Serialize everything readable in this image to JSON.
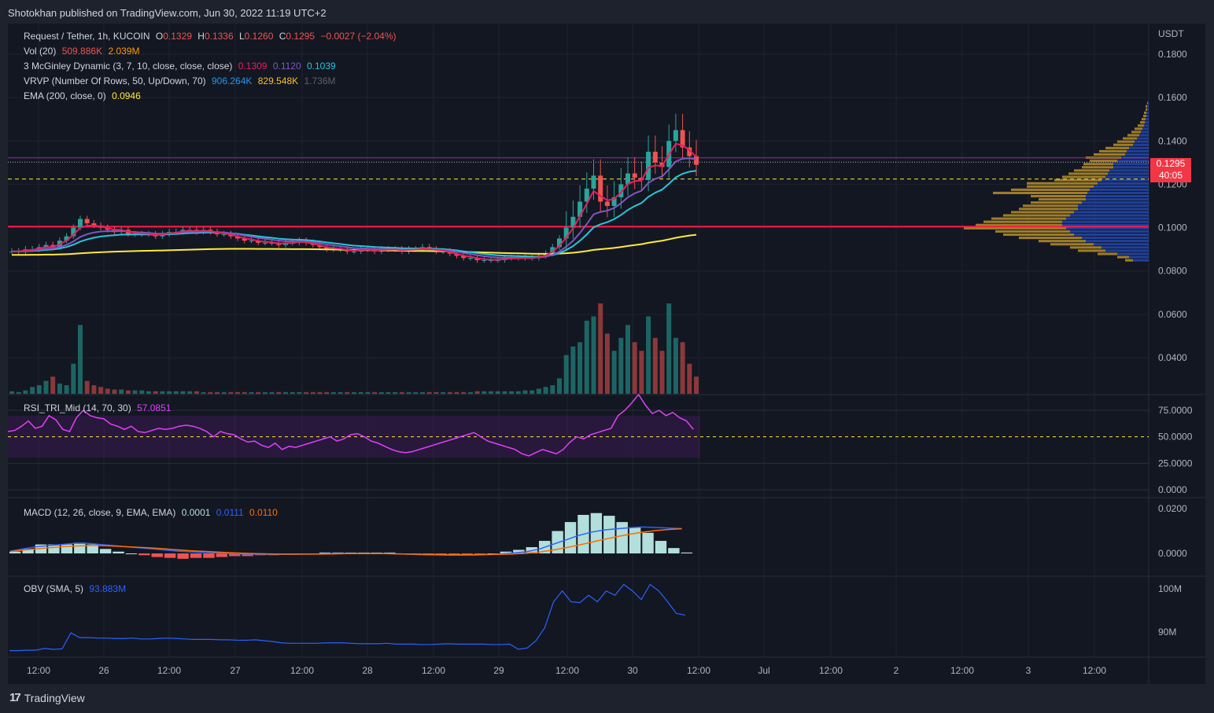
{
  "header": {
    "published": "Shotokhan published on TradingView.com, Jun 30, 2022 11:19 UTC+2"
  },
  "brand": {
    "name": "TradingView"
  },
  "colors": {
    "bg": "#131722",
    "up": "#26a69a",
    "down": "#ef5350",
    "red_line": "#ff1744",
    "yellow": "#ffeb3b",
    "mcg1": "#e91e63",
    "mcg2": "#7e57c2",
    "mcg3": "#26c6da",
    "rsi": "#e040fb",
    "obv": "#2962ff"
  },
  "legend": {
    "main": {
      "symbol": "Request / Tether, 1h, KUCOIN",
      "o_label": "O",
      "o": "0.1329",
      "h_label": "H",
      "h": "0.1336",
      "l_label": "L",
      "l": "0.1260",
      "c_label": "C",
      "c": "0.1295",
      "change": "−0.0027 (−2.04%)"
    },
    "vol": {
      "label": "Vol (20)",
      "v1": "509.886K",
      "v2": "2.039M"
    },
    "mcginley": {
      "label": "3 McGinley Dynamic (3, 7, 10, close, close, close)",
      "v1": "0.1309",
      "v2": "0.1120",
      "v3": "0.1039"
    },
    "vrvp": {
      "label": "VRVP (Number Of Rows, 50, Up/Down, 70)",
      "v1": "906.264K",
      "v2": "829.548K",
      "v3": "1.736M"
    },
    "ema": {
      "label": "EMA (200, close, 0)",
      "v1": "0.0946"
    },
    "rsi": {
      "label": "RSI_TRI_Mid (14, 70, 30)",
      "v1": "57.0851"
    },
    "macd": {
      "label": "MACD (12, 26, close, 9, EMA, EMA)",
      "v1": "0.0001",
      "v2": "0.0111",
      "v3": "0.0110"
    },
    "obv": {
      "label": "OBV (SMA, 5)",
      "v1": "93.883M"
    }
  },
  "price_tag": {
    "price": "0.1295",
    "countdown": "40:05"
  },
  "chart_data": [
    {
      "type": "candlestick",
      "title": "Request / Tether, 1h, KUCOIN",
      "ylabel": "USDT",
      "ylim": [
        0.02,
        0.19
      ],
      "y_ticks": [
        "0.1800",
        "0.1600",
        "0.1400",
        "0.1200",
        "0.1000",
        "0.0800",
        "0.0600",
        "0.0400"
      ],
      "x_ticks": [
        "12:00",
        "26",
        "12:00",
        "27",
        "12:00",
        "28",
        "12:00",
        "29",
        "12:00",
        "30",
        "12:00",
        "Jul",
        "12:00",
        "2",
        "12:00",
        "3",
        "12:00"
      ],
      "close": [
        0.089,
        0.089,
        0.09,
        0.09,
        0.091,
        0.092,
        0.091,
        0.094,
        0.096,
        0.1,
        0.104,
        0.102,
        0.101,
        0.1,
        0.099,
        0.098,
        0.099,
        0.097,
        0.097,
        0.097,
        0.097,
        0.096,
        0.097,
        0.098,
        0.098,
        0.099,
        0.099,
        0.098,
        0.099,
        0.098,
        0.097,
        0.097,
        0.096,
        0.095,
        0.094,
        0.094,
        0.093,
        0.093,
        0.093,
        0.092,
        0.093,
        0.093,
        0.094,
        0.093,
        0.092,
        0.091,
        0.09,
        0.09,
        0.09,
        0.089,
        0.089,
        0.09,
        0.09,
        0.089,
        0.09,
        0.09,
        0.09,
        0.089,
        0.09,
        0.09,
        0.091,
        0.09,
        0.089,
        0.089,
        0.088,
        0.087,
        0.086,
        0.086,
        0.085,
        0.085,
        0.085,
        0.085,
        0.086,
        0.086,
        0.086,
        0.086,
        0.086,
        0.087,
        0.088,
        0.091,
        0.095,
        0.1,
        0.105,
        0.112,
        0.118,
        0.124,
        0.112,
        0.11,
        0.114,
        0.12,
        0.125,
        0.123,
        0.122,
        0.135,
        0.13,
        0.128,
        0.14,
        0.145,
        0.137,
        0.133,
        0.129
      ],
      "horizontal_lines": [
        {
          "value": 0.1005,
          "color": "#ff1744",
          "style": "solid"
        },
        {
          "value": 0.1224,
          "color": "#ffeb3b",
          "style": "dashed"
        },
        {
          "value": 0.1322,
          "color": "#9c27b0",
          "style": "solid"
        },
        {
          "value": 0.1302,
          "color": "#b0bec5",
          "style": "dotted"
        }
      ],
      "ema200_last": 0.0946,
      "mcginley_last": [
        0.1309,
        0.112,
        0.1039
      ]
    },
    {
      "type": "bar",
      "title": "Vol (20)",
      "values": [
        0.3,
        0.2,
        0.4,
        0.8,
        1.0,
        1.5,
        2.0,
        1.2,
        1.0,
        3.5,
        8.0,
        1.5,
        1.0,
        0.8,
        0.6,
        0.5,
        0.5,
        0.4,
        0.4,
        0.4,
        0.3,
        0.3,
        0.3,
        0.3,
        0.3,
        0.3,
        0.3,
        0.3,
        0.2,
        0.2,
        0.2,
        0.2,
        0.2,
        0.2,
        0.2,
        0.2,
        0.2,
        0.2,
        0.2,
        0.2,
        0.2,
        0.2,
        0.2,
        0.2,
        0.2,
        0.2,
        0.2,
        0.2,
        0.2,
        0.2,
        0.2,
        0.2,
        0.2,
        0.2,
        0.2,
        0.2,
        0.2,
        0.2,
        0.2,
        0.2,
        0.2,
        0.2,
        0.2,
        0.2,
        0.2,
        0.2,
        0.2,
        0.2,
        0.3,
        0.3,
        0.3,
        0.3,
        0.3,
        0.3,
        0.3,
        0.4,
        0.4,
        0.6,
        0.8,
        1.0,
        1.8,
        4.5,
        5.5,
        6.0,
        8.5,
        9.0,
        10.5,
        7.0,
        5.0,
        6.5,
        8.0,
        6.0,
        5.0,
        9.0,
        6.5,
        5.0,
        10.5,
        6.5,
        6.0,
        3.5,
        2.0
      ]
    },
    {
      "type": "line",
      "title": "RSI_TRI_Mid (14, 70, 30)",
      "ylim": [
        0,
        90
      ],
      "y_ticks": [
        "75.0000",
        "50.0000",
        "25.0000",
        "0.0000"
      ],
      "values": [
        55,
        56,
        60,
        65,
        58,
        60,
        70,
        66,
        57,
        55,
        68,
        75,
        70,
        68,
        67,
        62,
        60,
        57,
        60,
        55,
        54,
        56,
        58,
        57,
        58,
        60,
        61,
        60,
        58,
        55,
        50,
        55,
        53,
        52,
        48,
        45,
        46,
        42,
        40,
        44,
        38,
        41,
        40,
        42,
        44,
        46,
        48,
        50,
        46,
        48,
        52,
        53,
        50,
        46,
        44,
        41,
        38,
        36,
        35,
        36,
        38,
        40,
        42,
        44,
        46,
        48,
        50,
        52,
        54,
        50,
        46,
        44,
        42,
        40,
        38,
        34,
        32,
        35,
        38,
        36,
        34,
        38,
        45,
        50,
        48,
        52,
        54,
        56,
        58,
        70,
        75,
        82,
        90,
        80,
        72,
        75,
        70,
        73,
        68,
        65,
        57
      ]
    },
    {
      "type": "line",
      "title": "MACD (12, 26, close, 9, EMA, EMA)",
      "ylim": [
        -0.004,
        0.024
      ],
      "y_ticks": [
        "0.0200",
        "0.0000"
      ],
      "series": [
        {
          "values": [
            0.001,
            0.002,
            0.003,
            0.0035,
            0.004,
            0.0045,
            0.0045,
            0.004,
            0.0035,
            0.003,
            0.0025,
            0.002,
            0.0015,
            0.001,
            0.0007,
            0.0004,
            0.0002,
            0.0,
            -0.0002,
            -0.0003,
            -0.0004,
            -0.0004,
            -0.0004,
            -0.0003,
            -0.0002,
            -0.0001,
            0.0,
            0.0,
            0.0,
            0.0,
            -0.0002,
            -0.0004,
            -0.0006,
            -0.0007,
            -0.0008,
            -0.0008,
            -0.0007,
            -0.0005,
            -0.0002,
            0.0002,
            0.0008,
            0.002,
            0.004,
            0.006,
            0.008,
            0.0095,
            0.0105,
            0.011,
            0.0115,
            0.0118,
            0.0116,
            0.0113,
            0.0111
          ]
        },
        {
          "values": [
            0.0008,
            0.0015,
            0.002,
            0.0025,
            0.003,
            0.0033,
            0.0035,
            0.0035,
            0.0033,
            0.003,
            0.0027,
            0.0024,
            0.002,
            0.0016,
            0.0012,
            0.0009,
            0.0006,
            0.0003,
            0.0001,
            -0.0001,
            -0.0002,
            -0.0003,
            -0.0003,
            -0.0003,
            -0.0003,
            -0.0002,
            -0.0001,
            -0.0001,
            -0.0001,
            -0.0001,
            -0.0002,
            -0.0003,
            -0.0004,
            -0.0005,
            -0.0006,
            -0.0006,
            -0.0006,
            -0.0005,
            -0.0004,
            -0.0002,
            0.0001,
            0.0006,
            0.0015,
            0.0025,
            0.0037,
            0.005,
            0.0063,
            0.0075,
            0.0086,
            0.0095,
            0.0102,
            0.0107,
            0.011
          ]
        }
      ]
    },
    {
      "type": "line",
      "title": "OBV (SMA, 5)",
      "ylim": [
        84,
        102
      ],
      "y_ticks": [
        "100M",
        "90M"
      ],
      "values": [
        85.7,
        85.7,
        85.8,
        85.8,
        86.2,
        86.0,
        86.1,
        89.8,
        88.7,
        88.7,
        88.6,
        88.6,
        88.5,
        88.5,
        88.6,
        88.4,
        88.4,
        88.5,
        88.6,
        88.5,
        88.4,
        88.3,
        88.3,
        88.3,
        88.2,
        88.2,
        88.1,
        88.1,
        88.2,
        88.0,
        87.8,
        87.5,
        87.4,
        87.4,
        87.4,
        87.4,
        87.5,
        87.5,
        87.5,
        87.4,
        87.3,
        87.3,
        87.3,
        87.4,
        87.2,
        87.2,
        87.2,
        87.1,
        87.1,
        87.2,
        87.3,
        87.2,
        87.2,
        87.2,
        87.2,
        87.1,
        87.1,
        87.2,
        86.0,
        86.3,
        88.0,
        91.0,
        97.0,
        99.5,
        97.0,
        96.8,
        98.5,
        97.0,
        99.5,
        98.5,
        101.0,
        99.5,
        97.5,
        101.0,
        99.5,
        97.0,
        94.3,
        93.9
      ]
    },
    {
      "type": "bar",
      "title": "VRVP (Number Of Rows, 50, Up/Down, 70)",
      "orientation": "horizontal",
      "price_range": [
        0.084,
        0.158
      ],
      "up_volume": [
        20,
        25,
        40,
        55,
        60,
        70,
        80,
        85,
        95,
        100,
        105,
        110,
        110,
        105,
        100,
        95,
        90,
        90,
        85,
        80,
        80,
        78,
        75,
        70,
        65,
        60,
        55,
        52,
        50,
        45,
        45,
        40,
        35,
        30,
        28,
        25,
        20,
        18,
        15,
        12,
        10,
        8,
        6,
        5,
        4,
        3,
        3,
        2,
        2,
        1
      ],
      "down_volume": [
        10,
        15,
        25,
        35,
        40,
        55,
        60,
        80,
        90,
        95,
        130,
        110,
        100,
        95,
        85,
        80,
        75,
        70,
        65,
        60,
        70,
        120,
        100,
        85,
        90,
        60,
        55,
        50,
        45,
        40,
        38,
        35,
        45,
        40,
        35,
        30,
        25,
        22,
        18,
        15,
        12,
        10,
        8,
        6,
        5,
        4,
        3,
        2,
        2,
        1
      ]
    }
  ]
}
